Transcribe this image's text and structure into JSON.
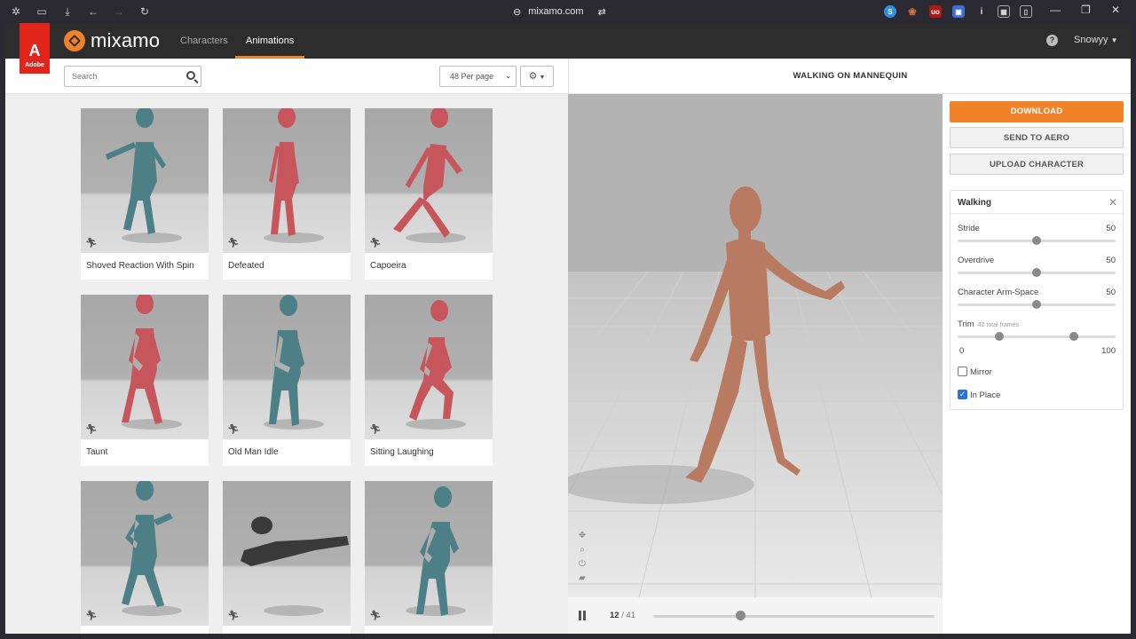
{
  "browser": {
    "url": "mixamo.com"
  },
  "app": {
    "adobe_badge": "Adobe",
    "logo_text": "mixamo",
    "nav": [
      {
        "label": "Characters"
      },
      {
        "label": "Animations"
      }
    ],
    "user": "Snowyy"
  },
  "toolbar": {
    "search_placeholder": "Search",
    "per_page": "48 Per page"
  },
  "animations": [
    {
      "label": "Shoved Reaction With Spin",
      "color": "#4d7f86"
    },
    {
      "label": "Defeated",
      "color": "#c7565c"
    },
    {
      "label": "Capoeira",
      "color": "#c7565c"
    },
    {
      "label": "Taunt",
      "color": "#c7565c"
    },
    {
      "label": "Old Man Idle",
      "color": "#4d7f86"
    },
    {
      "label": "Sitting Laughing",
      "color": "#c7565c"
    },
    {
      "label": "",
      "color": "#4d7f86"
    },
    {
      "label": "",
      "color": "#3a3a3a"
    },
    {
      "label": "",
      "color": "#4d7f86"
    }
  ],
  "viewer": {
    "title": "WALKING ON MANNEQUIN",
    "current_frame": "12",
    "total_frames": "/ 41",
    "progress": 0.31
  },
  "actions": {
    "download": "DOWNLOAD",
    "send": "SEND TO AERO",
    "upload": "UPLOAD CHARACTER"
  },
  "settings": {
    "title": "Walking",
    "stride_label": "Stride",
    "stride_value": "50",
    "overdrive_label": "Overdrive",
    "overdrive_value": "50",
    "armspace_label": "Character Arm-Space",
    "armspace_value": "50",
    "trim_label": "Trim",
    "trim_sub": "42 total frames",
    "trim_min": "0",
    "trim_max": "100",
    "mirror_label": "Mirror",
    "mirror_checked": false,
    "inplace_label": "In Place",
    "inplace_checked": true
  },
  "colors": {
    "accent": "#f0832a",
    "adobe_red": "#e1251b",
    "mannequin": "#b97a62"
  }
}
